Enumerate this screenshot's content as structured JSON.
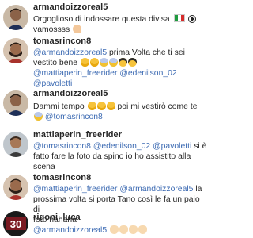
{
  "comments": [
    {
      "username": "armandoizzoreal5",
      "text1": "Orgoglioso di indossare questa divisa",
      "text2": "vamossss"
    },
    {
      "username": "tomasrincon8",
      "mention1": "@armandoizzoreal5",
      "text1": "prima Volta che ti sei",
      "text2": "vestito bene",
      "mention2": "@mattiaperin_freerider",
      "mention3": "@edenilson_02",
      "mention4": "@pavoletti"
    },
    {
      "username": "armandoizzoreal5",
      "text1": "Dammi tempo",
      "text2": "poi mi vestirò come te",
      "mention1": "@tomasrincon8"
    },
    {
      "username": "mattiaperin_freerider",
      "mention1": "@tomasrincon8",
      "mention2": "@edenilson_02",
      "mention3": "@pavoletti",
      "text1": "si è",
      "text2": "fatto fare la foto da spino io ho assistito alla",
      "text3": "scena"
    },
    {
      "username": "tomasrincon8",
      "mention1": "@mattiaperin_freerider",
      "mention2": "@armandoizzoreal5",
      "text1": "la",
      "text2": "prossima volta si porta Tano così le fa un paio di",
      "text3": "foto hahaha"
    },
    {
      "username": "rigoni_luca",
      "mention1": "@armandoizzoreal5",
      "avatar_text": "30"
    }
  ],
  "colors": {
    "username": "#262626",
    "mention": "#3d6bb3",
    "text": "#262626",
    "background": "#ffffff"
  },
  "icons": [
    "avatar",
    "italy-flag-emoji",
    "soccer-ball-emoji",
    "muscle-emoji",
    "laughing-emoji",
    "screaming-emoji",
    "sunglasses-emoji",
    "clapping-emoji"
  ]
}
